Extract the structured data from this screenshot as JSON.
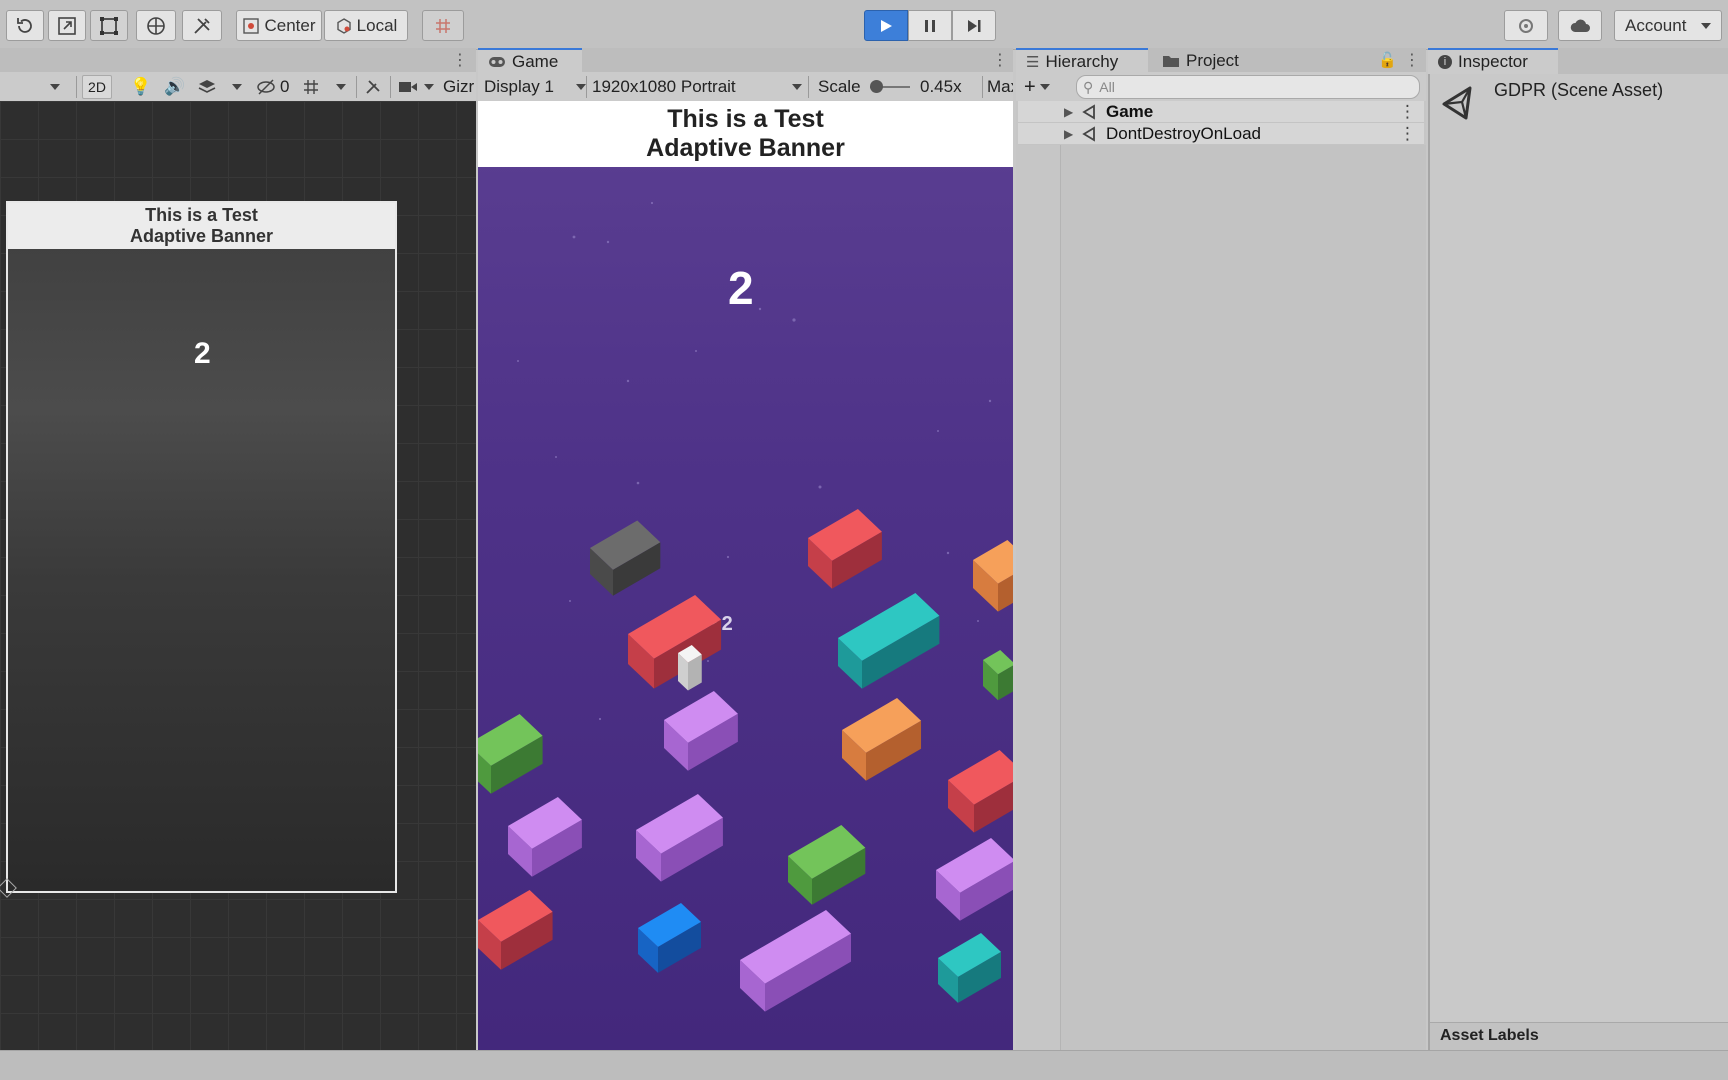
{
  "toolbar": {
    "tool_icons": [
      "rotate-tool-icon",
      "scale-tool-icon",
      "rect-tool-icon",
      "transform-tool-icon",
      "custom-tool-icon"
    ],
    "pivot_label": "Center",
    "space_label": "Local",
    "account_label": "Account"
  },
  "scene_toolbar": {
    "mode_2d": "2D",
    "hidden_count": "0",
    "gizmos_label": "Gizr"
  },
  "game_view": {
    "tab_label": "Game",
    "display": "Display 1",
    "resolution": "1920x1080 Portrait",
    "scale_label": "Scale",
    "scale_value": "0.45x",
    "maximize_label": "Max",
    "banner_line1": "This is a Test",
    "banner_line2": "Adaptive Banner",
    "score": "2",
    "bonus": "+2",
    "bg_color": "#4e3288"
  },
  "scene_view": {
    "banner_line1": "This is a Test",
    "banner_line2": "Adaptive Banner",
    "score": "2"
  },
  "hierarchy": {
    "tab_label": "Hierarchy",
    "project_tab_label": "Project",
    "search_placeholder": "All",
    "items": [
      {
        "label": "Game"
      },
      {
        "label": "DontDestroyOnLoad"
      }
    ]
  },
  "inspector": {
    "tab_label": "Inspector",
    "asset_title": "GDPR (Scene Asset)",
    "asset_labels": "Asset Labels"
  }
}
